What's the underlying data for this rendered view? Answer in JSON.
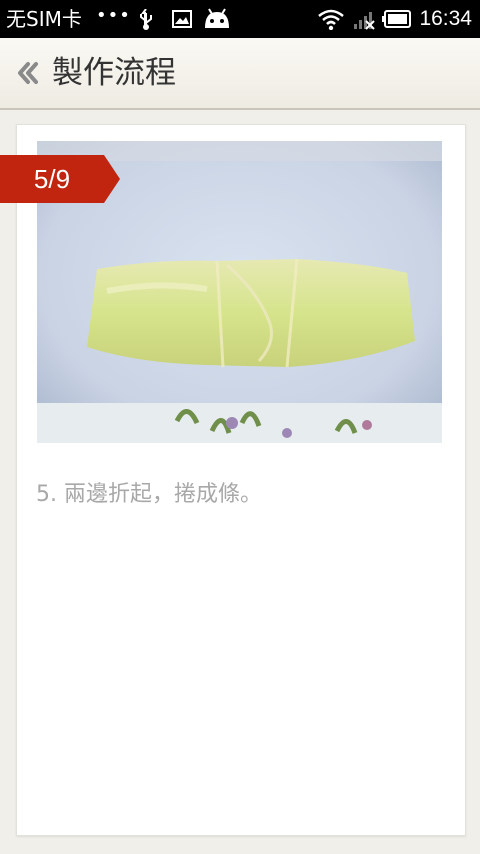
{
  "status_bar": {
    "carrier": "无SIM卡",
    "dots": "•••",
    "time": "16:34",
    "icons": [
      "usb-icon",
      "image-notification-icon",
      "android-icon",
      "wifi-icon",
      "no-signal-icon",
      "battery-icon"
    ]
  },
  "header": {
    "title": "製作流程",
    "back_icon": "chevron-left-icon"
  },
  "step": {
    "badge": "5/9",
    "current": 5,
    "total": 9,
    "description": "5. 兩邊折起，捲成條。"
  },
  "colors": {
    "badge_red": "#c2250f",
    "status_bar": "#000000",
    "header_bg": "#f4f2ec",
    "description_text": "#a8a8a8"
  }
}
